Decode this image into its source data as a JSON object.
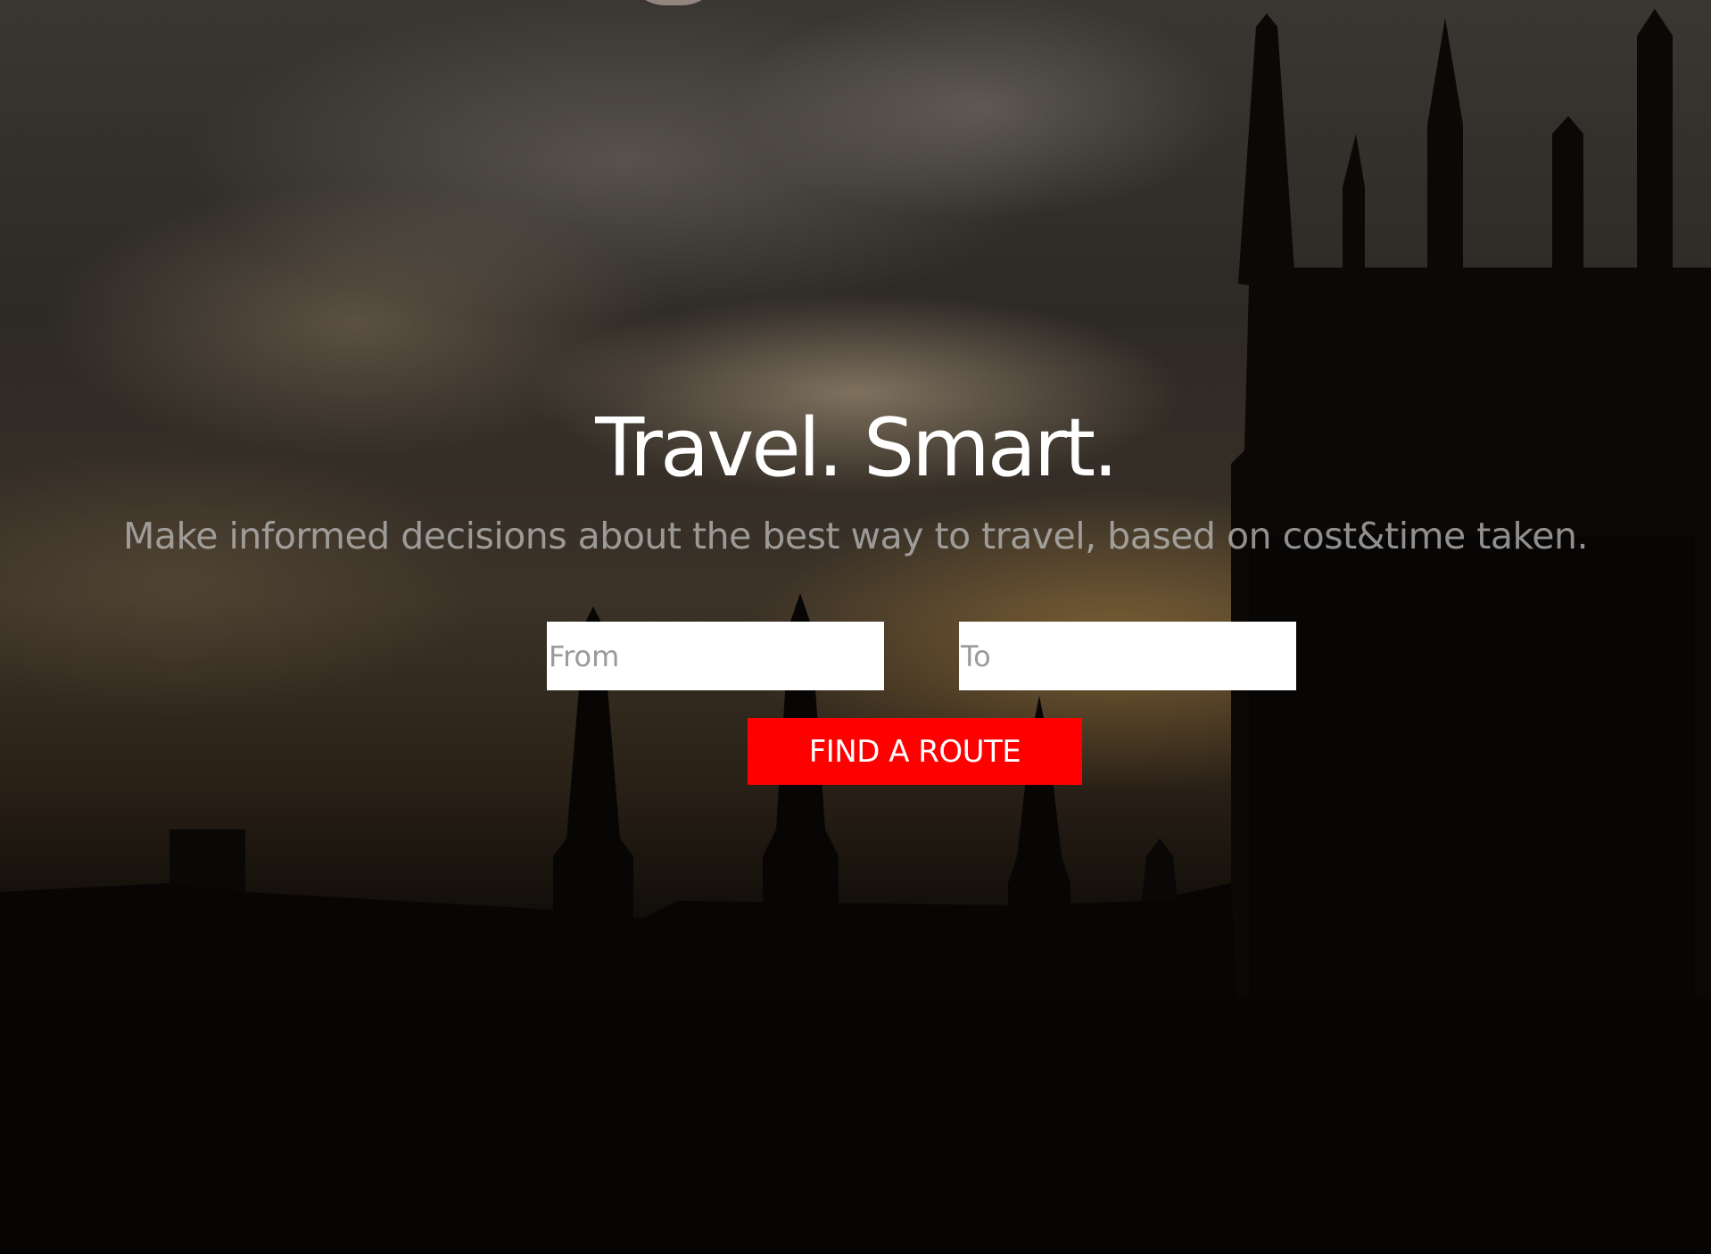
{
  "hero": {
    "headline": "Travel. Smart.",
    "tagline": "Make informed decisions about the best way to travel, based on cost&time taken."
  },
  "search": {
    "from_placeholder": "From",
    "to_placeholder": "To",
    "submit_label": "FIND A ROUTE"
  },
  "colors": {
    "accent": "#ff0000",
    "headline": "#ffffff",
    "tagline": "#bebebe"
  },
  "background": {
    "scene": "night-sky-clouds-cathedral-silhouette"
  }
}
